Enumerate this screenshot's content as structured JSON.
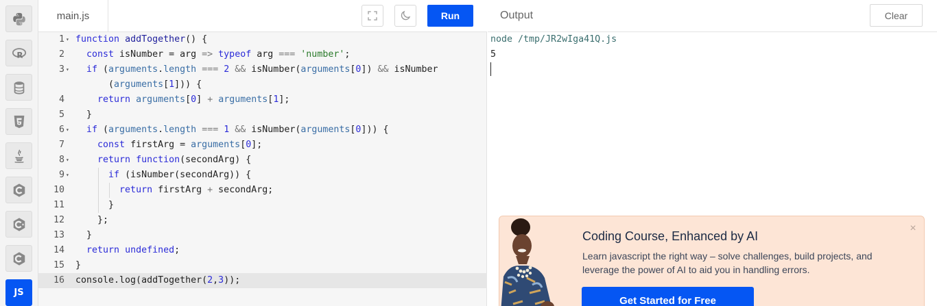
{
  "sidebar": {
    "items": [
      {
        "icon": "python-icon",
        "label": "Python"
      },
      {
        "icon": "r-icon",
        "label": "R"
      },
      {
        "icon": "database-icon",
        "label": "SQL"
      },
      {
        "icon": "html5-icon",
        "label": "HTML"
      },
      {
        "icon": "java-icon",
        "label": "Java"
      },
      {
        "icon": "c-icon",
        "label": "C"
      },
      {
        "icon": "cpp-icon",
        "label": "C++"
      },
      {
        "icon": "csharp-icon",
        "label": "C#"
      },
      {
        "icon": "js-icon",
        "label": "JS"
      }
    ],
    "active_label": "JS",
    "accent_color": "#0556f3"
  },
  "editor": {
    "file_name": "main.js",
    "run_label": "Run",
    "active_line": 16,
    "lines": [
      {
        "n": "1",
        "fold": true,
        "code": "function addTogether() {"
      },
      {
        "n": "2",
        "fold": false,
        "code": "  const isNumber = arg => typeof arg === 'number';"
      },
      {
        "n": "3",
        "fold": true,
        "code": "  if (arguments.length === 2 && isNumber(arguments[0]) && isNumber"
      },
      {
        "n": "",
        "fold": false,
        "code": "      (arguments[1])) {"
      },
      {
        "n": "4",
        "fold": false,
        "code": "    return arguments[0] + arguments[1];"
      },
      {
        "n": "5",
        "fold": false,
        "code": "  }"
      },
      {
        "n": "6",
        "fold": true,
        "code": "  if (arguments.length === 1 && isNumber(arguments[0])) {"
      },
      {
        "n": "7",
        "fold": false,
        "code": "    const firstArg = arguments[0];"
      },
      {
        "n": "8",
        "fold": true,
        "code": "    return function(secondArg) {"
      },
      {
        "n": "9",
        "fold": true,
        "code": "      if (isNumber(secondArg)) {"
      },
      {
        "n": "10",
        "fold": false,
        "code": "        return firstArg + secondArg;"
      },
      {
        "n": "11",
        "fold": false,
        "code": "      }"
      },
      {
        "n": "12",
        "fold": false,
        "code": "    };"
      },
      {
        "n": "13",
        "fold": false,
        "code": "  }"
      },
      {
        "n": "14",
        "fold": false,
        "code": "  return undefined;"
      },
      {
        "n": "15",
        "fold": false,
        "code": "}"
      },
      {
        "n": "16",
        "fold": false,
        "code": "console.log(addTogether(2,3));"
      }
    ]
  },
  "output": {
    "title": "Output",
    "clear_label": "Clear",
    "lines": [
      "node /tmp/JR2wIga41Q.js",
      "5"
    ]
  },
  "ad": {
    "title": "Coding Course, Enhanced by AI",
    "text": "Learn javascript the right way – solve challenges, build projects, and leverage the power of AI to aid you in handling errors.",
    "cta_label": "Get Started for Free",
    "close_icon": "close-icon"
  }
}
